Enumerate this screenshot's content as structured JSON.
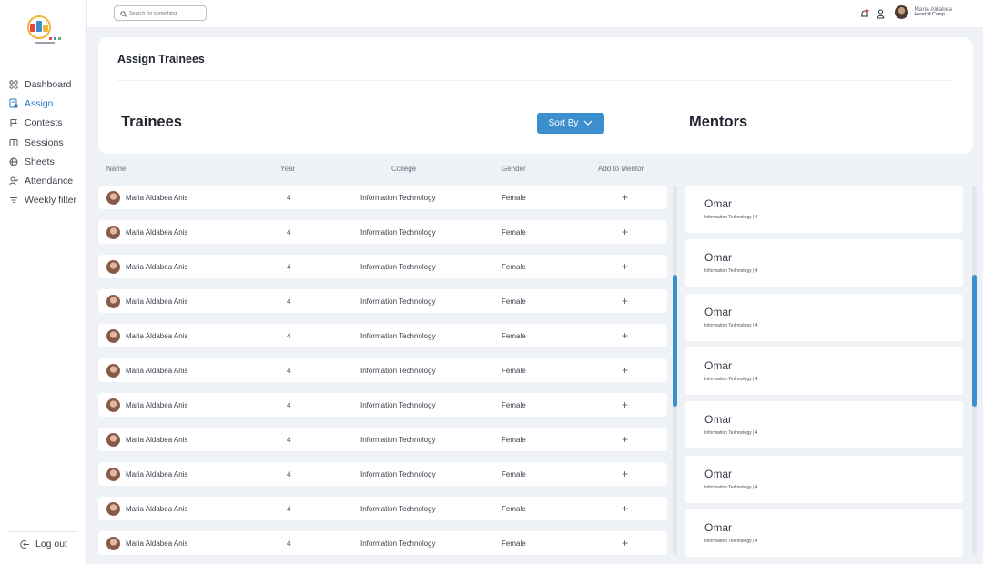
{
  "sidebar": {
    "items": [
      {
        "label": "Dashboard",
        "icon": "grid-icon"
      },
      {
        "label": "Assign",
        "icon": "assign-icon"
      },
      {
        "label": "Contests",
        "icon": "flag-icon"
      },
      {
        "label": "Sessions",
        "icon": "book-icon"
      },
      {
        "label": "Sheets",
        "icon": "globe-icon"
      },
      {
        "label": "Attendance",
        "icon": "user-check-icon"
      },
      {
        "label": "Weekly filter",
        "icon": "filter-icon"
      }
    ],
    "active_index": 1,
    "logout_label": "Log out"
  },
  "topbar": {
    "search_placeholder": "Search for something",
    "user_name": "Maria Aldabea",
    "user_role": "Head of Camp"
  },
  "header": {
    "title": "Assign Trainees",
    "trainees_heading": "Trainees",
    "mentors_heading": "Mentors",
    "sort_label": "Sort By"
  },
  "table": {
    "columns": [
      "Name",
      "Year",
      "College",
      "Gender",
      "Add to Mentor"
    ],
    "rows": [
      {
        "name": "Maria Aldabea Anis",
        "year": "4",
        "college": "Information Technology",
        "gender": "Female",
        "action": "+"
      },
      {
        "name": "Maria Aldabea Anis",
        "year": "4",
        "college": "Information Technology",
        "gender": "Female",
        "action": "+"
      },
      {
        "name": "Maria Aldabea Anis",
        "year": "4",
        "college": "Information Technology",
        "gender": "Female",
        "action": "+"
      },
      {
        "name": "Maria Aldabea Anis",
        "year": "4",
        "college": "Information Technology",
        "gender": "Female",
        "action": "+"
      },
      {
        "name": "Maria Aldabea Anis",
        "year": "4",
        "college": "Information Technology",
        "gender": "Female",
        "action": "+"
      },
      {
        "name": "Maria Aldabea Anis",
        "year": "4",
        "college": "Information Technology",
        "gender": "Female",
        "action": "+"
      },
      {
        "name": "Maria Aldabea Anis",
        "year": "4",
        "college": "Information Technology",
        "gender": "Female",
        "action": "+"
      },
      {
        "name": "Maria Aldabea Anis",
        "year": "4",
        "college": "Information Technology",
        "gender": "Female",
        "action": "+"
      },
      {
        "name": "Maria Aldabea Anis",
        "year": "4",
        "college": "Information Technology",
        "gender": "Female",
        "action": "+"
      },
      {
        "name": "Maria Aldabea Anis",
        "year": "4",
        "college": "Information Technology",
        "gender": "Female",
        "action": "+"
      },
      {
        "name": "Maria Aldabea Anis",
        "year": "4",
        "college": "Information Technology",
        "gender": "Female",
        "action": "+"
      }
    ]
  },
  "mentors": [
    {
      "name": "Omar",
      "detail": "Information Technology | 4"
    },
    {
      "name": "Omar",
      "detail": "Information Technology | 4"
    },
    {
      "name": "Omar",
      "detail": "Information Technology | 4"
    },
    {
      "name": "Omar",
      "detail": "Information Technology | 4"
    },
    {
      "name": "Omar",
      "detail": "Information Technology | 4"
    },
    {
      "name": "Omar",
      "detail": "Information Technology | 4"
    },
    {
      "name": "Omar",
      "detail": "Information Technology | 4"
    }
  ],
  "colors": {
    "accent": "#3c8fcf",
    "active_nav": "#2b7cc4",
    "background": "#eef1f6",
    "notification_dot": "#e5483b"
  }
}
